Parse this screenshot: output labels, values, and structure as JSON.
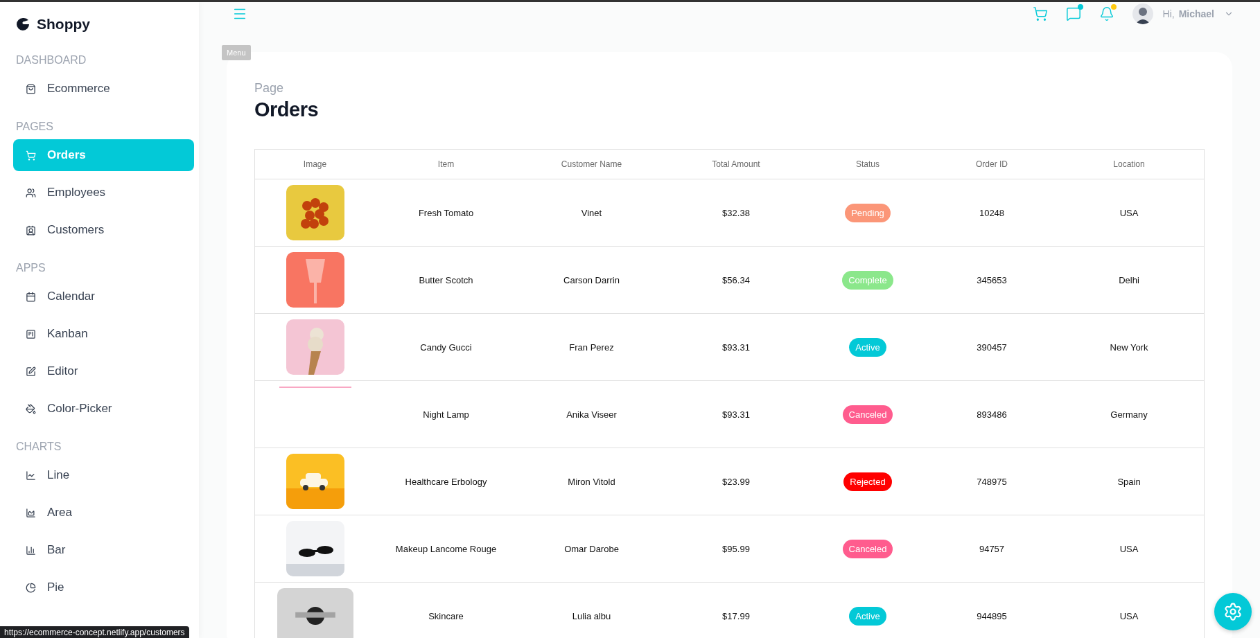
{
  "sidebar": {
    "logo": "Shoppy",
    "sections": [
      {
        "title": "DASHBOARD",
        "items": [
          {
            "label": "Ecommerce",
            "selected": false
          }
        ]
      },
      {
        "title": "PAGES",
        "items": [
          {
            "label": "Orders",
            "selected": true
          },
          {
            "label": "Employees",
            "selected": false
          },
          {
            "label": "Customers",
            "selected": false
          }
        ]
      },
      {
        "title": "APPS",
        "items": [
          {
            "label": "Calendar",
            "selected": false
          },
          {
            "label": "Kanban",
            "selected": false
          },
          {
            "label": "Editor",
            "selected": false
          },
          {
            "label": "Color-Picker",
            "selected": false
          }
        ]
      },
      {
        "title": "CHARTS",
        "items": [
          {
            "label": "Line",
            "selected": false
          },
          {
            "label": "Area",
            "selected": false
          },
          {
            "label": "Bar",
            "selected": false
          },
          {
            "label": "Pie",
            "selected": false
          }
        ]
      }
    ]
  },
  "header": {
    "menu_tooltip": "Menu",
    "actions": [
      {
        "kind": "cart"
      },
      {
        "kind": "chat",
        "color": "#03c9d7"
      },
      {
        "kind": "notification",
        "color": "#fec90f"
      }
    ],
    "user": {
      "greeting": "Hi,",
      "name": "Michael"
    }
  },
  "page": {
    "category": "Page",
    "title": "Orders"
  },
  "table": {
    "columns": [
      "Image",
      "Item",
      "Customer Name",
      "Total Amount",
      "Status",
      "Order ID",
      "Location"
    ],
    "rows": [
      {
        "item": "Fresh Tomato",
        "customer": "Vinet",
        "total": "$32.38",
        "status": {
          "label": "Pending",
          "color": "#fb9678"
        },
        "order_id": "10248",
        "location": "USA"
      },
      {
        "item": "Butter Scotch",
        "customer": "Carson Darrin",
        "total": "$56.34",
        "status": {
          "label": "Complete",
          "color": "#8be78b"
        },
        "order_id": "345653",
        "location": "Delhi"
      },
      {
        "item": "Candy Gucci",
        "customer": "Fran Perez",
        "total": "$93.31",
        "status": {
          "label": "Active",
          "color": "#03c9d7"
        },
        "order_id": "390457",
        "location": "New York"
      },
      {
        "image": {
          "kind": "broken"
        },
        "item": "Night Lamp",
        "customer": "Anika Viseer",
        "total": "$93.31",
        "status": {
          "label": "Canceled",
          "color": "#ff5c8e"
        },
        "order_id": "893486",
        "location": "Germany"
      },
      {
        "item": "Healthcare Erbology",
        "customer": "Miron Vitold",
        "total": "$23.99",
        "status": {
          "label": "Rejected",
          "color": "#ff0000"
        },
        "order_id": "748975",
        "location": "Spain"
      },
      {
        "item": "Makeup Lancome Rouge",
        "customer": "Omar Darobe",
        "total": "$95.99",
        "status": {
          "label": "Canceled",
          "color": "#ff5c8e"
        },
        "order_id": "94757",
        "location": "USA"
      },
      {
        "item": "Skincare",
        "customer": "Lulia albu",
        "total": "$17.99",
        "status": {
          "label": "Active",
          "color": "#03c9d7"
        },
        "order_id": "944895",
        "location": "USA"
      }
    ]
  },
  "status_url": "https://ecommerce-concept.netlify.app/customers"
}
